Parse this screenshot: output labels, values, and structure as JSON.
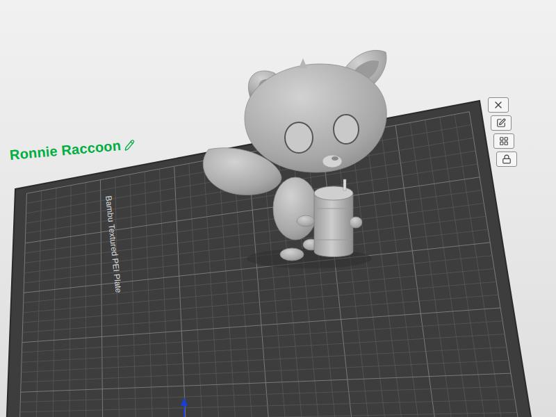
{
  "model": {
    "name": "Ronnie Raccoon"
  },
  "plate": {
    "label": "Bambu Textured PEI Plate"
  }
}
